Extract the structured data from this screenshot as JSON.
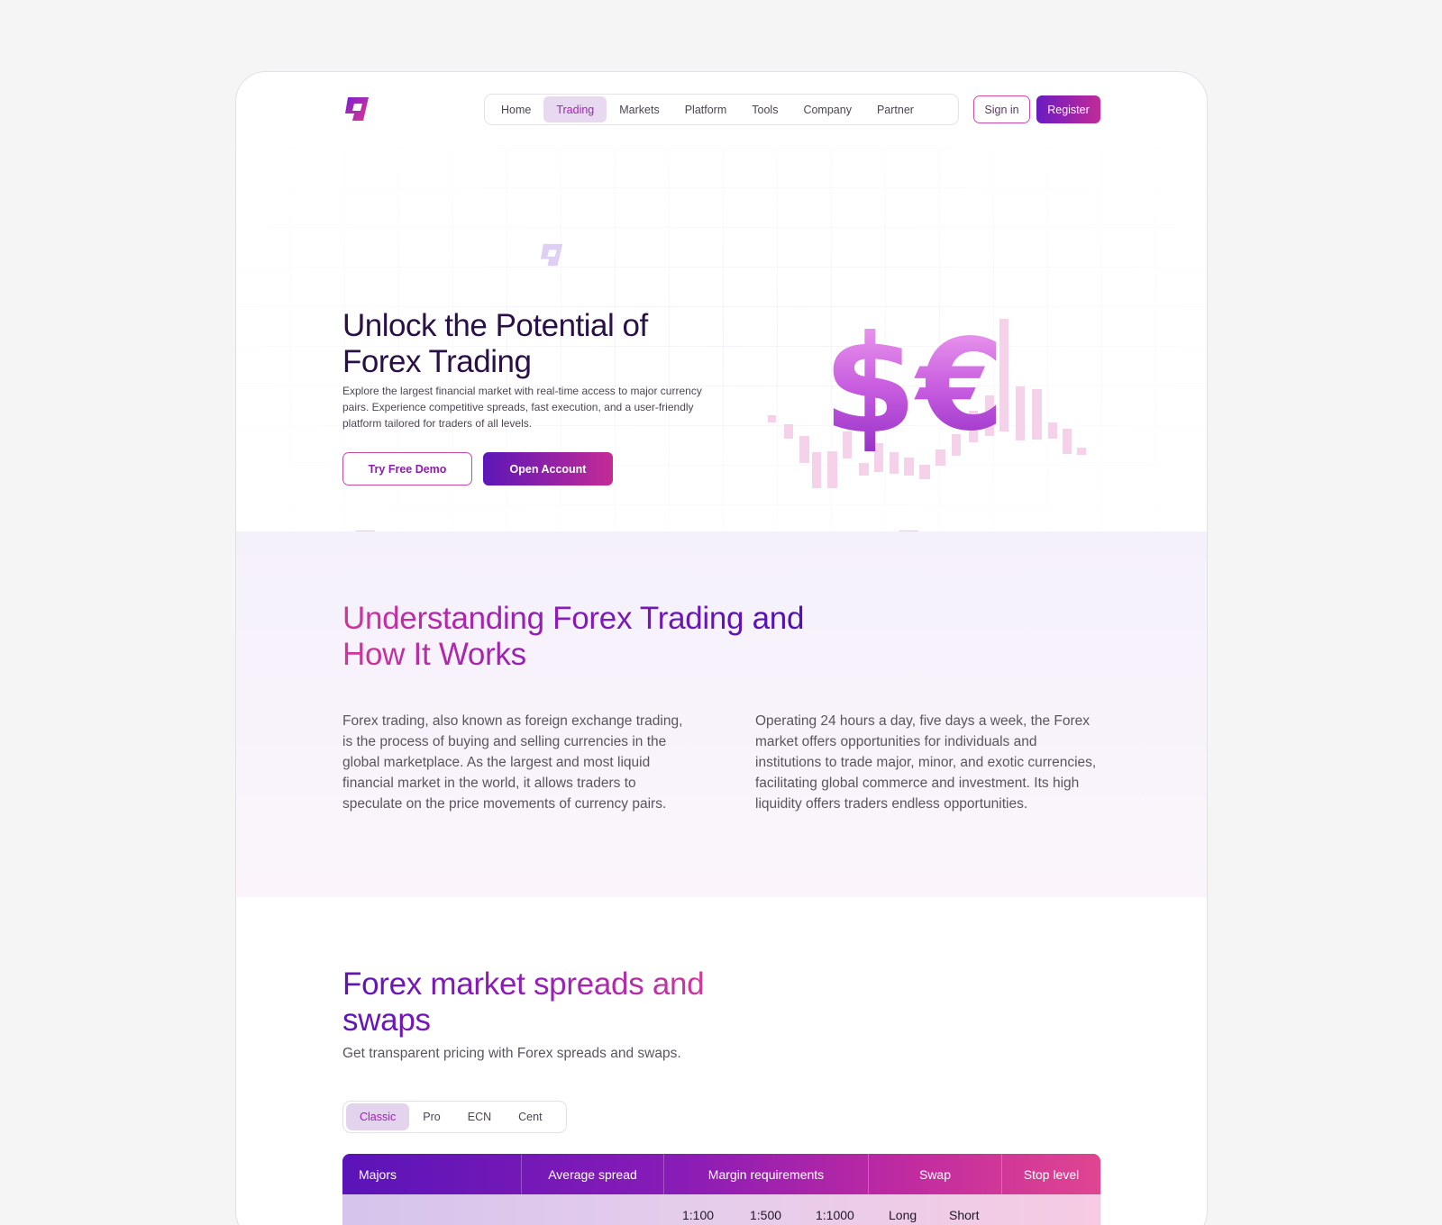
{
  "header": {
    "nav": [
      "Home",
      "Trading",
      "Markets",
      "Platform",
      "Tools",
      "Company",
      "Partner"
    ],
    "active_nav": "Trading",
    "signin_label": "Sign in",
    "register_label": "Register"
  },
  "hero": {
    "title": "Unlock the Potential of Forex Trading",
    "subtitle": "Explore the largest financial market with real-time access to major currency pairs. Experience competitive spreads, fast execution, and a user-friendly platform tailored for traders of all levels.",
    "demo_label": "Try Free Demo",
    "open_label": "Open Account",
    "symbols": [
      "$",
      "€"
    ]
  },
  "understanding": {
    "title": "Understanding Forex Trading and How It Works",
    "col_left": "Forex trading, also known as foreign exchange trading, is the process of buying and selling currencies in the global marketplace. As the largest and most liquid financial market in the world, it allows traders to speculate on the price movements of currency pairs.",
    "col_right": "Operating 24 hours a day, five days a week, the Forex market offers opportunities for individuals and institutions to trade major, minor, and exotic currencies, facilitating global commerce and investment. Its high liquidity offers traders endless opportunities."
  },
  "spreads": {
    "title": "Forex market spreads and swaps",
    "subtitle": "Get transparent pricing with Forex spreads and swaps.",
    "tabs": [
      "Classic",
      "Pro",
      "ECN",
      "Cent"
    ],
    "active_tab": "Classic",
    "table": {
      "headers": [
        "Majors",
        "Average spread",
        "Margin requirements",
        "Swap",
        "Stop level"
      ],
      "subheaders": [
        "1:100",
        "1:500",
        "1:1000",
        "Long",
        "Short"
      ]
    }
  },
  "colors": {
    "primary": "#5c17b8",
    "accent": "#c42b96",
    "active_tab_bg": "#e7daf0"
  }
}
